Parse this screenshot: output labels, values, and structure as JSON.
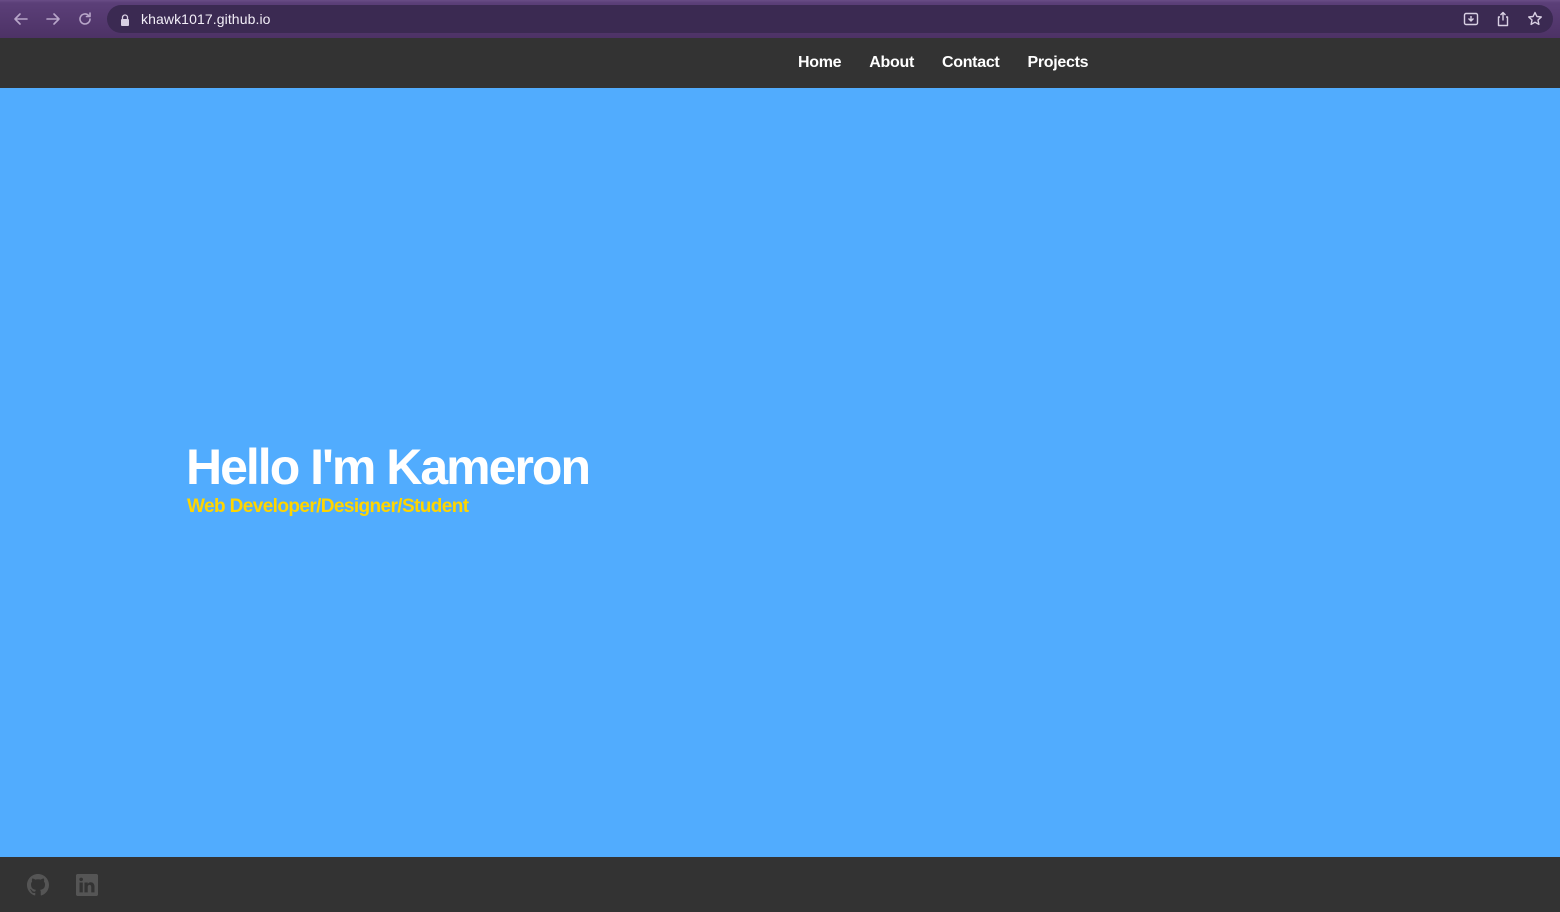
{
  "browser": {
    "url": "khawk1017.github.io",
    "icons": [
      "back-arrow-icon",
      "forward-arrow-icon",
      "reload-icon",
      "lock-icon",
      "install-icon",
      "share-icon",
      "bookmark-star-icon"
    ]
  },
  "nav": {
    "links": [
      "Home",
      "About",
      "Contact",
      "Projects"
    ]
  },
  "hero": {
    "title": "Hello I'm Kameron",
    "subtitle": "Web Developer/Designer/Student"
  },
  "footer": {
    "icons": [
      "github-icon",
      "linkedin-icon"
    ]
  },
  "colors": {
    "hero_background": "#51acfe",
    "subtitle": "#ffd500",
    "nav_background": "#333333",
    "browser_frame": "#5b3f78"
  }
}
